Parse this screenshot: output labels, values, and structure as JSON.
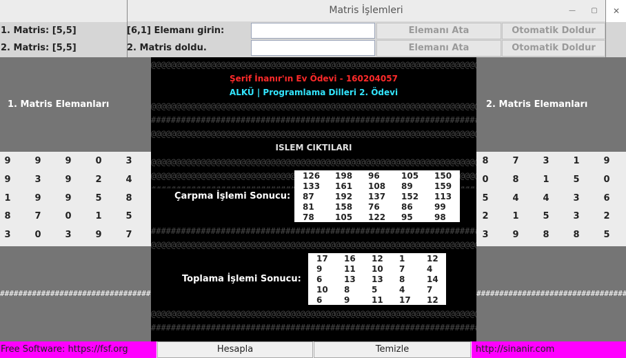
{
  "window": {
    "title": "Matris İşlemleri"
  },
  "row1": {
    "label_left": "1. Matris: [5,5]",
    "label_mid": "[6,1] Elemanı girin:",
    "input_value": "",
    "assign_button": "Elemanı Ata",
    "autofill_button": "Otomatik Doldur"
  },
  "row2": {
    "label_left": "2. Matris: [5,5]",
    "label_mid": "2. Matris doldu.",
    "input_value": "",
    "assign_button": "Elemanı Ata",
    "autofill_button": "Otomatik Doldur"
  },
  "left_panel": {
    "heading": "1. Matris Elemanları",
    "matrix": [
      [
        "9",
        "9",
        "9",
        "0",
        "3"
      ],
      [
        "9",
        "3",
        "9",
        "2",
        "4"
      ],
      [
        "1",
        "9",
        "9",
        "5",
        "8"
      ],
      [
        "8",
        "7",
        "0",
        "1",
        "5"
      ],
      [
        "3",
        "0",
        "3",
        "9",
        "7"
      ]
    ]
  },
  "right_panel": {
    "heading": "2. Matris Elemanları",
    "matrix": [
      [
        "8",
        "7",
        "3",
        "1",
        "9"
      ],
      [
        "0",
        "8",
        "1",
        "5",
        "0"
      ],
      [
        "5",
        "4",
        "4",
        "3",
        "6"
      ],
      [
        "2",
        "1",
        "5",
        "3",
        "2"
      ],
      [
        "3",
        "9",
        "8",
        "8",
        "5"
      ]
    ]
  },
  "center": {
    "author_line": "Şerif İnanır'ın Ev Ödevi - 160204057",
    "course_line": "ALKÜ | Programlama Dilleri 2. Ödevi",
    "output_heading": "ISLEM CIKTILARI",
    "multiply_label": "Çarpma İşlemi Sonucu:",
    "multiply_matrix": [
      [
        "126",
        "198",
        "96",
        "105",
        "150"
      ],
      [
        "133",
        "161",
        "108",
        "89",
        "159"
      ],
      [
        "87",
        "192",
        "137",
        "152",
        "113"
      ],
      [
        "81",
        "158",
        "76",
        "86",
        "99"
      ],
      [
        "78",
        "105",
        "122",
        "95",
        "98"
      ]
    ],
    "add_label": "Toplama İşlemi Sonucu:",
    "add_matrix": [
      [
        "17",
        "16",
        "12",
        "1",
        "12"
      ],
      [
        "9",
        "11",
        "10",
        "7",
        "4"
      ],
      [
        "6",
        "13",
        "13",
        "8",
        "14"
      ],
      [
        "10",
        "8",
        "5",
        "4",
        "7"
      ],
      [
        "6",
        "9",
        "11",
        "17",
        "12"
      ]
    ],
    "at_pattern": "@@@@@@@@@@@@@@@@@@@@@@@@@@@@@@@@@@@@@@@@@@@@@@@@@@@@@@@@@@@@@@@@@@@@@@@@@@@@@@@@@@@@@@@@@@@@@@@",
    "hash_pattern": "###################################################################################################"
  },
  "side_hash_left": "#################################",
  "side_hash_right": "#################################",
  "footer": {
    "left_link": "Free Software: https://fsf.org",
    "calc_button": "Hesapla",
    "clear_button": "Temizle",
    "right_link": "http://sinanir.com"
  },
  "colors": {
    "author": "#ff2a2a",
    "course": "#33e6ff",
    "magenta": "#ff00ff",
    "side_panel": "#757575"
  }
}
